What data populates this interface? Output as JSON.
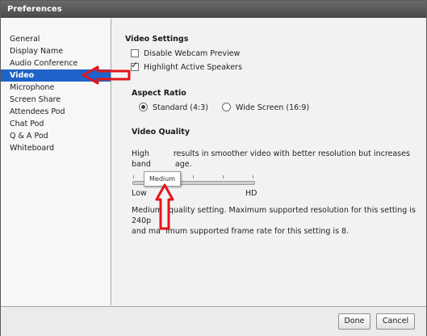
{
  "window": {
    "title": "Preferences"
  },
  "sidebar": {
    "items": [
      {
        "label": "General",
        "active": false
      },
      {
        "label": "Display Name",
        "active": false
      },
      {
        "label": "Audio Conference",
        "active": false
      },
      {
        "label": "Video",
        "active": true
      },
      {
        "label": "Microphone",
        "active": false
      },
      {
        "label": "Screen Share",
        "active": false
      },
      {
        "label": "Attendees Pod",
        "active": false
      },
      {
        "label": "Chat Pod",
        "active": false
      },
      {
        "label": "Q & A Pod",
        "active": false
      },
      {
        "label": "Whiteboard",
        "active": false
      }
    ]
  },
  "video_settings": {
    "title": "Video Settings",
    "disable_webcam_preview": {
      "label": "Disable Webcam Preview",
      "checked": false
    },
    "highlight_active_speakers": {
      "label": "Highlight Active Speakers",
      "checked": true
    }
  },
  "aspect_ratio": {
    "title": "Aspect Ratio",
    "standard": {
      "label": "Standard (4:3)",
      "selected": true
    },
    "wide": {
      "label": "Wide Screen (16:9)",
      "selected": false
    }
  },
  "video_quality": {
    "title": "Video Quality",
    "desc_line1": "High",
    "desc_line1_rest": "results in smoother video with better resolution but increases",
    "desc_line2_start": "band",
    "desc_line2_rest": "age.",
    "slider_low_label": "Low",
    "slider_high_label": "HD",
    "slider_tooltip": "Medium",
    "slider_value_fraction": 0.25,
    "info_line1_start": "Medium",
    "info_line1_rest": "quality setting. Maximum supported resolution for this setting is 240p",
    "info_line2_start": "and ma",
    "info_line2_rest": "imum supported frame rate for this setting is 8."
  },
  "footer": {
    "done_label": "Done",
    "cancel_label": "Cancel"
  },
  "colors": {
    "selection": "#1f62c9",
    "annotation": "#e0161b",
    "titlebar": "#555555"
  }
}
